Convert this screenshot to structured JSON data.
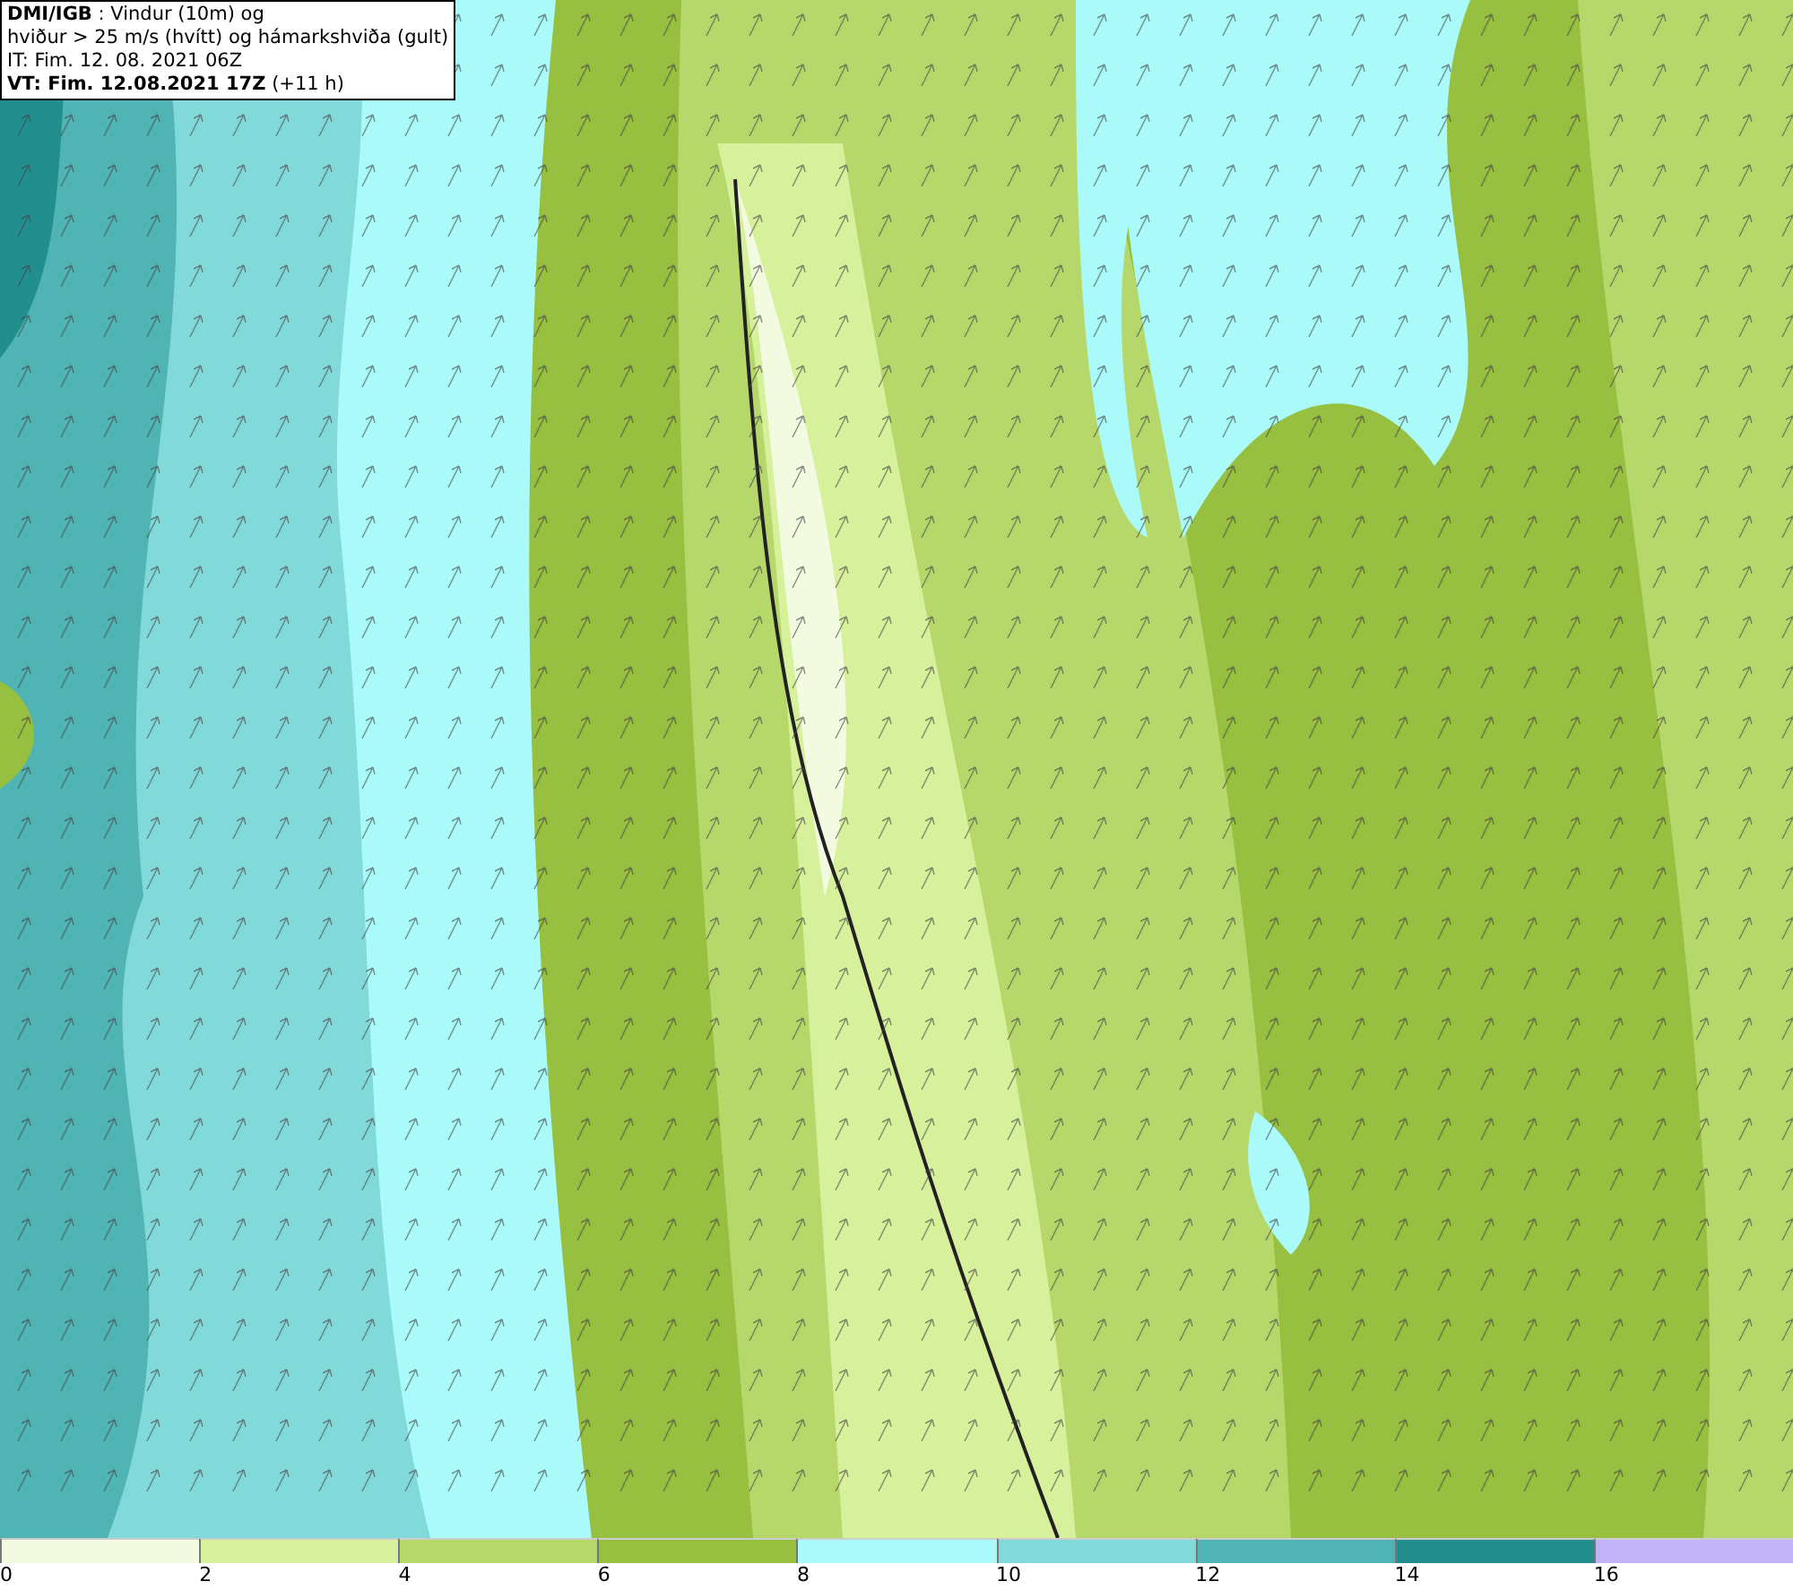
{
  "header": {
    "lines": [
      "**DMI/IGB** : Vindur (10m) og",
      "hviður > 25 m/s (hvítt) og hámarkshviða (gult)",
      "IT: Fim. 12. 08. 2021 06Z",
      "**VT: Fim. 12.08.2021 17Z** (+11 h)"
    ]
  },
  "legend": {
    "bins": [
      {
        "color": "#f2fbe0",
        "label": "0"
      },
      {
        "color": "#d6f09c",
        "label": "2"
      },
      {
        "color": "#b6d86a",
        "label": "4"
      },
      {
        "color": "#97bf40",
        "label": "6"
      },
      {
        "color": "#aafafa",
        "label": "8"
      },
      {
        "color": "#82d9d9",
        "label": "10"
      },
      {
        "color": "#50b4b4",
        "label": "12"
      },
      {
        "color": "#228e8e",
        "label": "14"
      },
      {
        "color": "#c3b4f8",
        "label": "16"
      }
    ]
  }
}
